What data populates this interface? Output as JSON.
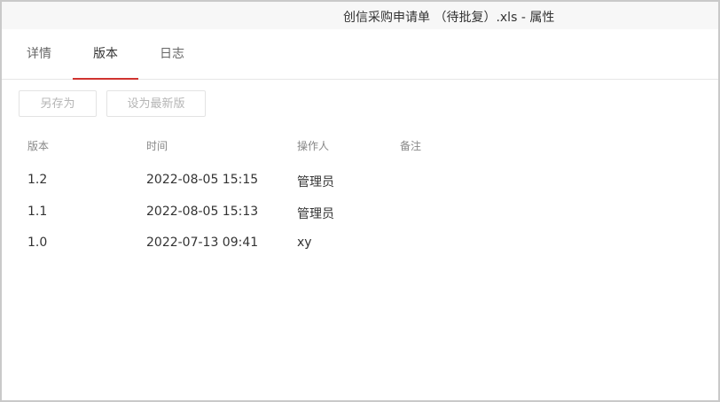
{
  "window": {
    "title": "创信采购申请单 （待批复）.xls - 属性"
  },
  "tabs": [
    {
      "label": "详情",
      "active": false
    },
    {
      "label": "版本",
      "active": true
    },
    {
      "label": "日志",
      "active": false
    }
  ],
  "toolbar": {
    "save_as_label": "另存为",
    "set_latest_label": "设为最新版"
  },
  "table": {
    "headers": {
      "version": "版本",
      "time": "时间",
      "operator": "操作人",
      "note": "备注"
    },
    "rows": [
      {
        "version": "1.2",
        "time": "2022-08-05 15:15",
        "operator": "管理员",
        "note": ""
      },
      {
        "version": "1.1",
        "time": "2022-08-05 15:13",
        "operator": "管理员",
        "note": ""
      },
      {
        "version": "1.0",
        "time": "2022-07-13 09:41",
        "operator": "xy",
        "note": ""
      }
    ]
  },
  "colors": {
    "accent": "#d0332f",
    "border": "#c9c9c9",
    "disabled_text": "#b5b5b5"
  }
}
